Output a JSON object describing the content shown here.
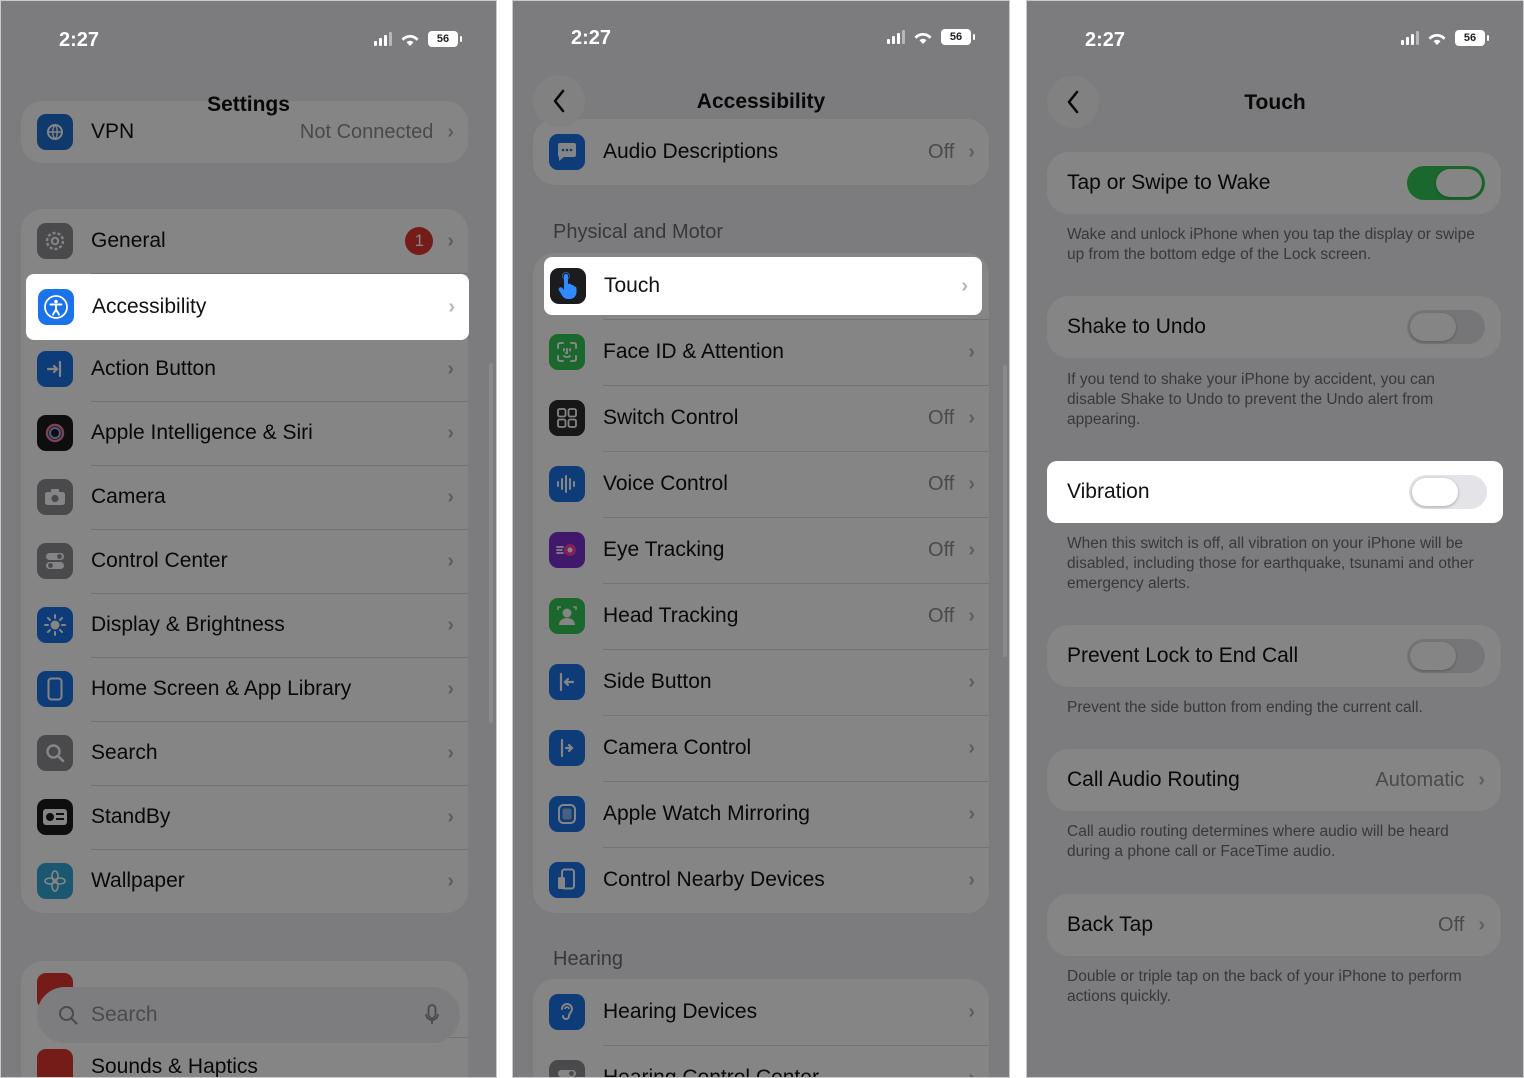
{
  "status": {
    "time": "2:27",
    "battery": "56"
  },
  "panel1": {
    "title": "Settings",
    "top_rows": [
      {
        "label": "VPN",
        "value": "Not Connected"
      }
    ],
    "items": [
      {
        "label": "General",
        "badge": "1"
      },
      {
        "label": "Accessibility"
      },
      {
        "label": "Action Button"
      },
      {
        "label": "Apple Intelligence & Siri"
      },
      {
        "label": "Camera"
      },
      {
        "label": "Control Center"
      },
      {
        "label": "Display & Brightness"
      },
      {
        "label": "Home Screen & App Library"
      },
      {
        "label": "Search"
      },
      {
        "label": "StandBy"
      },
      {
        "label": "Wallpaper"
      }
    ],
    "bottom_rows": [
      {
        "label": "Sounds & Haptics"
      }
    ],
    "search_placeholder": "Search"
  },
  "panel2": {
    "title": "Accessibility",
    "top_rows": [
      {
        "label": "Audio Descriptions",
        "value": "Off"
      }
    ],
    "section_physical": "Physical and Motor",
    "items": [
      {
        "label": "Touch"
      },
      {
        "label": "Face ID & Attention"
      },
      {
        "label": "Switch Control",
        "value": "Off"
      },
      {
        "label": "Voice Control",
        "value": "Off"
      },
      {
        "label": "Eye Tracking",
        "value": "Off"
      },
      {
        "label": "Head Tracking",
        "value": "Off"
      },
      {
        "label": "Side Button"
      },
      {
        "label": "Camera Control"
      },
      {
        "label": "Apple Watch Mirroring"
      },
      {
        "label": "Control Nearby Devices"
      }
    ],
    "section_hearing": "Hearing",
    "hearing_items": [
      {
        "label": "Hearing Devices"
      },
      {
        "label": "Hearing Control Center"
      }
    ]
  },
  "panel3": {
    "title": "Touch",
    "rows": [
      {
        "label": "Tap or Swipe to Wake",
        "toggle": true,
        "footer": "Wake and unlock iPhone when you tap the display or swipe up from the bottom edge of the Lock screen."
      },
      {
        "label": "Shake to Undo",
        "toggle": false,
        "footer": "If you tend to shake your iPhone by accident, you can disable Shake to Undo to prevent the Undo alert from appearing."
      },
      {
        "label": "Vibration",
        "toggle": false,
        "footer": "When this switch is off, all vibration on your iPhone will be disabled, including those for earthquake, tsunami and other emergency alerts."
      },
      {
        "label": "Prevent Lock to End Call",
        "toggle": false,
        "footer": "Prevent the side button from ending the current call."
      },
      {
        "label": "Call Audio Routing",
        "value": "Automatic",
        "footer": "Call audio routing determines where audio will be heard during a phone call or FaceTime audio."
      },
      {
        "label": "Back Tap",
        "value": "Off",
        "footer": "Double or triple tap on the back of your iPhone to perform actions quickly."
      }
    ]
  },
  "colors": {
    "accent_green": "#34c759",
    "badge_red": "#e0352f",
    "blue": "#1a73e8"
  }
}
